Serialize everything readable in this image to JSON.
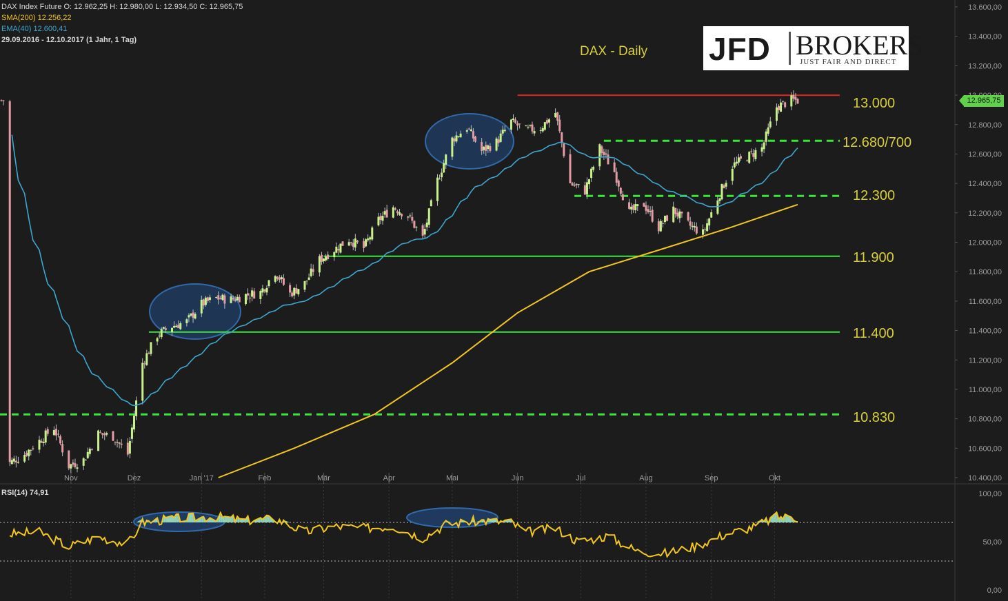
{
  "header": {
    "instrument_line": "DAX Index Future  O: 12.962,25  H: 12.980,00  L: 12.934,50  C: 12.965,75",
    "sma_line": "SMA(200)  12.256,22",
    "ema_line": "EMA(40)  12.600,41",
    "range_line": "29.09.2016 - 12.10.2017   (1 Jahr, 1 Tag)"
  },
  "logo": {
    "jfd": "JFD",
    "brokers": "BROKERS",
    "tagline": "JUST FAIR AND DIRECT"
  },
  "title": "DAX - Daily",
  "last_price_label": "12.965,75",
  "levels": [
    {
      "label": "13.000",
      "value": 13000,
      "color": "#e0241f",
      "style": "solid",
      "x_start": "Jun"
    },
    {
      "label": "12.680/700",
      "value": 12690,
      "color": "#3ee43e",
      "style": "dashed",
      "x_start": "Jul"
    },
    {
      "label": "12.300",
      "value": 12315,
      "color": "#3ee43e",
      "style": "dashed",
      "x_start": "Jun-end"
    },
    {
      "label": "11.900",
      "value": 11905,
      "color": "#3ee43e",
      "style": "solid",
      "x_start": "Mar"
    },
    {
      "label": "11.400",
      "value": 11390,
      "color": "#3ee43e",
      "style": "solid",
      "x_start": "Dec"
    },
    {
      "label": "10.830",
      "value": 10830,
      "color": "#3ee43e",
      "style": "dashed",
      "x_start": "start"
    }
  ],
  "chart_data": {
    "type": "candlestick",
    "price_axis": {
      "ylim": [
        10400,
        13600
      ],
      "ticks": [
        "13.600,00",
        "13.400,00",
        "13.200,00",
        "13.000,00",
        "12.800,00",
        "12.600,00",
        "12.400,00",
        "12.200,00",
        "12.000,00",
        "11.800,00",
        "11.600,00",
        "11.400,00",
        "11.200,00",
        "11.000,00",
        "10.800,00",
        "10.600,00",
        "10.400,00"
      ]
    },
    "x_labels": [
      "Nov",
      "Dez",
      "Jan '17",
      "Feb",
      "Mär",
      "Apr",
      "Mai",
      "Jun",
      "Jul",
      "Aug",
      "Sep",
      "Okt"
    ],
    "price_path": [
      [
        "2016-10-03",
        10500
      ],
      [
        "2016-10-10",
        10560
      ],
      [
        "2016-10-17",
        10650
      ],
      [
        "2016-10-24",
        10740
      ],
      [
        "2016-10-31",
        10480
      ],
      [
        "2016-11-07",
        10520
      ],
      [
        "2016-11-14",
        10700
      ],
      [
        "2016-11-21",
        10680
      ],
      [
        "2016-11-28",
        10560
      ],
      [
        "2016-12-05",
        11180
      ],
      [
        "2016-12-12",
        11370
      ],
      [
        "2016-12-19",
        11430
      ],
      [
        "2016-12-26",
        11460
      ],
      [
        "2017-01-02",
        11580
      ],
      [
        "2017-01-09",
        11620
      ],
      [
        "2017-01-16",
        11610
      ],
      [
        "2017-01-23",
        11640
      ],
      [
        "2017-01-30",
        11660
      ],
      [
        "2017-02-06",
        11800
      ],
      [
        "2017-02-13",
        11650
      ],
      [
        "2017-02-20",
        11720
      ],
      [
        "2017-02-27",
        11880
      ],
      [
        "2017-03-06",
        11950
      ],
      [
        "2017-03-13",
        12020
      ],
      [
        "2017-03-20",
        11960
      ],
      [
        "2017-03-27",
        12150
      ],
      [
        "2017-04-03",
        12240
      ],
      [
        "2017-04-10",
        12180
      ],
      [
        "2017-04-17",
        12030
      ],
      [
        "2017-04-24",
        12420
      ],
      [
        "2017-05-01",
        12700
      ],
      [
        "2017-05-08",
        12780
      ],
      [
        "2017-05-15",
        12620
      ],
      [
        "2017-05-22",
        12680
      ],
      [
        "2017-05-29",
        12820
      ],
      [
        "2017-06-05",
        12760
      ],
      [
        "2017-06-12",
        12780
      ],
      [
        "2017-06-19",
        12880
      ],
      [
        "2017-06-26",
        12400
      ],
      [
        "2017-07-03",
        12350
      ],
      [
        "2017-07-10",
        12640
      ],
      [
        "2017-07-17",
        12480
      ],
      [
        "2017-07-24",
        12200
      ],
      [
        "2017-07-31",
        12260
      ],
      [
        "2017-08-07",
        12100
      ],
      [
        "2017-08-14",
        12220
      ],
      [
        "2017-08-21",
        12120
      ],
      [
        "2017-08-28",
        12060
      ],
      [
        "2017-09-04",
        12300
      ],
      [
        "2017-09-11",
        12520
      ],
      [
        "2017-09-18",
        12580
      ],
      [
        "2017-09-25",
        12640
      ],
      [
        "2017-10-02",
        12920
      ],
      [
        "2017-10-09",
        12965
      ]
    ],
    "sma200_last": 12256.22,
    "ema40_last": 12600.41,
    "rsi": {
      "label": "RSI(14)  74,91",
      "ylim": [
        0,
        100
      ],
      "ticks": [
        "100,00",
        "50,00",
        "0,00"
      ],
      "levels": [
        70,
        30
      ],
      "path": [
        [
          "2016-10-03",
          58
        ],
        [
          "2016-10-17",
          60
        ],
        [
          "2016-10-31",
          45
        ],
        [
          "2016-11-14",
          55
        ],
        [
          "2016-11-28",
          48
        ],
        [
          "2016-12-05",
          70
        ],
        [
          "2016-12-19",
          74
        ],
        [
          "2017-01-09",
          76
        ],
        [
          "2017-01-23",
          72
        ],
        [
          "2017-02-06",
          74
        ],
        [
          "2017-02-20",
          60
        ],
        [
          "2017-03-06",
          66
        ],
        [
          "2017-03-20",
          64
        ],
        [
          "2017-04-03",
          66
        ],
        [
          "2017-04-17",
          54
        ],
        [
          "2017-04-28",
          68
        ],
        [
          "2017-05-15",
          72
        ],
        [
          "2017-05-29",
          70
        ],
        [
          "2017-06-05",
          60
        ],
        [
          "2017-06-19",
          64
        ],
        [
          "2017-06-30",
          50
        ],
        [
          "2017-07-14",
          56
        ],
        [
          "2017-07-28",
          40
        ],
        [
          "2017-08-11",
          38
        ],
        [
          "2017-08-25",
          46
        ],
        [
          "2017-09-08",
          58
        ],
        [
          "2017-09-22",
          66
        ],
        [
          "2017-10-02",
          76
        ],
        [
          "2017-10-12",
          74.91
        ]
      ]
    }
  },
  "colors": {
    "background": "#1c1c1c",
    "candle_up": "#c7f28a",
    "candle_down": "#e59aa4",
    "sma": "#f2c61c",
    "ema": "#3ea7cf",
    "rsi_line": "#f2c61c",
    "rsi_fill": "#9fe3c6",
    "ellipse_fill": "#1f3a5e",
    "ellipse_stroke": "#3269a8",
    "grid": "#4a4a4a",
    "axis_text": "#9c9c9c",
    "level_text": "#d8cf3a"
  }
}
